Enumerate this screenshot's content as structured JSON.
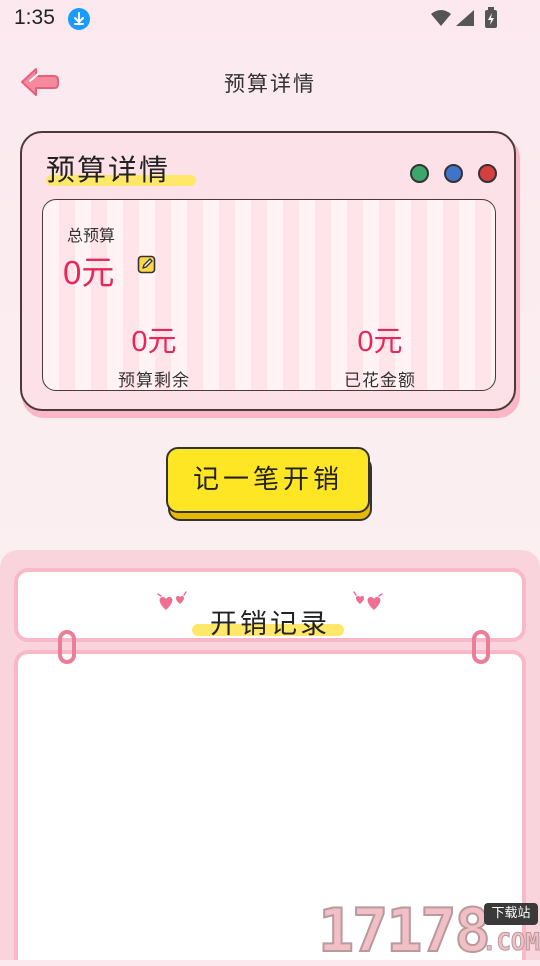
{
  "status_bar": {
    "time": "1:35"
  },
  "header": {
    "title": "预算详情"
  },
  "budget_card": {
    "title": "预算详情",
    "total_label": "总预算",
    "total_value": "0元",
    "remaining_value": "0元",
    "remaining_label": "预算剩余",
    "spent_value": "0元",
    "spent_label": "已花金额"
  },
  "actions": {
    "add_expense_label": "记一笔开销"
  },
  "records": {
    "title": "开销记录"
  },
  "watermark": {
    "number": "17178",
    "badge": "下载站",
    "domain": ".COM"
  },
  "colors": {
    "accent_pink": "#e8265a",
    "button_yellow": "#ffe625",
    "highlight": "#ffe76a",
    "border_pink": "#f9b8c8"
  }
}
